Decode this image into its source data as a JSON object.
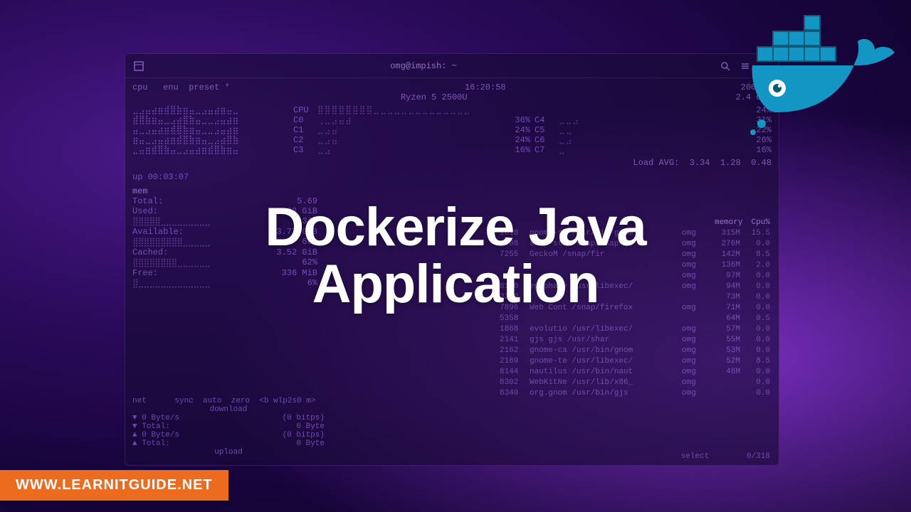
{
  "overlay": {
    "title": "Dockerize Java\nApplication"
  },
  "banner": {
    "text": "WWW.LEARNITGUIDE.NET"
  },
  "terminal": {
    "title": "omg@impish: ~",
    "top_labels": {
      "cpu": "cpu",
      "menu": "enu",
      "preset": "preset *"
    },
    "clock": "16:20:58",
    "refresh": "2000ms",
    "cpu_model": "Ryzen 5 2500U",
    "cpu_freq": "2.4 GHz",
    "cpu_main": {
      "label": "CPU",
      "pct": "24%"
    },
    "cores": [
      {
        "id": "C0",
        "pct": "36%",
        "pair_id": "C4",
        "pair_pct": "31%"
      },
      {
        "id": "C1",
        "pct": "24%",
        "pair_id": "C5",
        "pair_pct": "22%"
      },
      {
        "id": "C2",
        "pct": "24%",
        "pair_id": "C6",
        "pair_pct": "26%"
      },
      {
        "id": "C3",
        "pct": "16%",
        "pair_id": "C7",
        "pair_pct": "16%"
      }
    ],
    "load": {
      "label": "Load AVG:",
      "v1": "3.34",
      "v2": "1.28",
      "v3": "0.48"
    },
    "uptime": "up 00:03:07",
    "mem": {
      "header": "mem",
      "total_label": "Total:",
      "total": "5.69",
      "used_label": "Used:",
      "used": "1.92 GiB",
      "used_pct": "34%",
      "avail_label": "Available:",
      "avail": "3.77 GiB",
      "avail_pct": "66%",
      "cached_label": "Cached:",
      "cached": "3.52 GiB",
      "cached_pct": "62%",
      "free_label": "Free:",
      "free": "336 MiB",
      "free_pct": "6%"
    },
    "proc": {
      "header_mem": "memory",
      "header_cpu": "Cpu%",
      "rows": [
        {
          "pid": "1618",
          "cmd": "gnome-sh /usr/bin/gnom",
          "user": "omg",
          "mem": "315M",
          "cpu": "15.5"
        },
        {
          "pid": "1908",
          "cmd": "snap-sto /snap/snap-st",
          "user": "omg",
          "mem": "276M",
          "cpu": "0.0"
        },
        {
          "pid": "7255",
          "cmd": "GeckoM  /snap/fir",
          "user": "omg",
          "mem": "142M",
          "cpu": "8.5"
        },
        {
          "pid": "",
          "cmd": "",
          "user": "omg",
          "mem": "136M",
          "cpu": "2.0"
        },
        {
          "pid": "",
          "cmd": "",
          "user": "omg",
          "mem": "97M",
          "cpu": "0.0"
        },
        {
          "pid": "8150",
          "cmd": "epiphany /usr/libexec/",
          "user": "omg",
          "mem": "94M",
          "cpu": "0.0"
        },
        {
          "pid": "2303",
          "cmd": "",
          "user": "",
          "mem": "73M",
          "cpu": "0.0"
        },
        {
          "pid": "7896",
          "cmd": "Web Cont /snap/firefox",
          "user": "omg",
          "mem": "71M",
          "cpu": "0.0"
        },
        {
          "pid": "5358",
          "cmd": "",
          "user": "",
          "mem": "64M",
          "cpu": "0.5"
        },
        {
          "pid": "1868",
          "cmd": "evolutio /usr/libexec/",
          "user": "omg",
          "mem": "57M",
          "cpu": "0.0"
        },
        {
          "pid": "2141",
          "cmd": "gjs      gjs /usr/shar",
          "user": "omg",
          "mem": "55M",
          "cpu": "0.0"
        },
        {
          "pid": "2162",
          "cmd": "gnome-ca /usr/bin/gnom",
          "user": "omg",
          "mem": "53M",
          "cpu": "0.0"
        },
        {
          "pid": "2169",
          "cmd": "gnome-te /usr/libexec/",
          "user": "omg",
          "mem": "52M",
          "cpu": "8.5"
        },
        {
          "pid": "8144",
          "cmd": "nautilus /usr/bin/naut",
          "user": "omg",
          "mem": "48M",
          "cpu": "0.0"
        },
        {
          "pid": "8302",
          "cmd": "WebKitNe /usr/lib/x86_",
          "user": "omg",
          "mem": "",
          "cpu": "0.0"
        },
        {
          "pid": "8340",
          "cmd": "org.gnom /usr/bin/gjs",
          "user": "omg",
          "mem": "",
          "cpu": "0.0"
        }
      ],
      "select": "select",
      "counter": "0/318"
    },
    "net": {
      "header": "net",
      "sync": "sync",
      "auto": "auto",
      "zero": "zero",
      "iface": "<b wlp2s0 m>",
      "download_label": "download",
      "down_rate": "▼ 0 Byte/s",
      "down_bits": "(0 bitps)",
      "down_total_label": "▼ Total:",
      "down_total": "0 Byte",
      "up_rate": "▲ 0 Byte/s",
      "up_bits": "(0 bitps)",
      "up_total_label": "▲ Total:",
      "up_total": "0 Byte",
      "upload_label": "upload"
    }
  },
  "icons": {
    "docker": "docker-whale-icon",
    "search": "search-icon",
    "menu": "hamburger-icon",
    "minimize": "minimize-icon",
    "tab": "tab-icon"
  }
}
